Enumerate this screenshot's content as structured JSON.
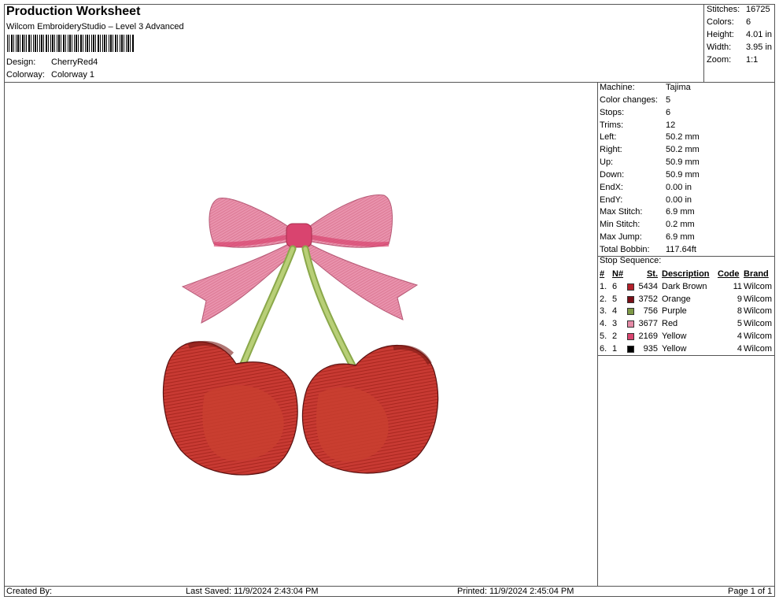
{
  "header": {
    "title": "Production Worksheet",
    "software": "Wilcom EmbroideryStudio – Level 3 Advanced",
    "design_label": "Design:",
    "design_value": "CherryRed4",
    "colorway_label": "Colorway:",
    "colorway_value": "Colorway 1"
  },
  "top_stats": [
    {
      "label": "Stitches:",
      "value": "16725"
    },
    {
      "label": "Colors:",
      "value": "6"
    },
    {
      "label": "Height:",
      "value": "4.01 in"
    },
    {
      "label": "Width:",
      "value": "3.95 in"
    },
    {
      "label": "Zoom:",
      "value": "1:1"
    }
  ],
  "machine_stats": [
    {
      "label": "Machine:",
      "value": "Tajima"
    },
    {
      "label": "Color changes:",
      "value": "5"
    },
    {
      "label": "Stops:",
      "value": "6"
    },
    {
      "label": "Trims:",
      "value": "12"
    },
    {
      "label": "Left:",
      "value": "50.2 mm"
    },
    {
      "label": "Right:",
      "value": "50.2 mm"
    },
    {
      "label": "Up:",
      "value": "50.9 mm"
    },
    {
      "label": "Down:",
      "value": "50.9 mm"
    },
    {
      "label": "EndX:",
      "value": "0.00 in"
    },
    {
      "label": "EndY:",
      "value": "0.00 in"
    },
    {
      "label": "Max Stitch:",
      "value": "6.9 mm"
    },
    {
      "label": "Min Stitch:",
      "value": "0.2 mm"
    },
    {
      "label": "Max Jump:",
      "value": "6.9 mm"
    },
    {
      "label": "Total Bobbin:",
      "value": "117.64ft"
    }
  ],
  "stop_sequence": {
    "label": "Stop Sequence:",
    "headers": {
      "num": "#",
      "n": "N#",
      "st": "St.",
      "description": "Description",
      "code": "Code",
      "brand": "Brand"
    },
    "rows": [
      {
        "num": "1.",
        "n": "6",
        "color": "#b3202a",
        "st": "5434",
        "description": "Dark Brown",
        "code": "11",
        "brand": "Wilcom"
      },
      {
        "num": "2.",
        "n": "5",
        "color": "#7a0f17",
        "st": "3752",
        "description": "Orange",
        "code": "9",
        "brand": "Wilcom"
      },
      {
        "num": "3.",
        "n": "4",
        "color": "#7f9a47",
        "st": "756",
        "description": "Purple",
        "code": "8",
        "brand": "Wilcom"
      },
      {
        "num": "4.",
        "n": "3",
        "color": "#e58aa6",
        "st": "3677",
        "description": "Red",
        "code": "5",
        "brand": "Wilcom"
      },
      {
        "num": "5.",
        "n": "2",
        "color": "#d9446f",
        "st": "2169",
        "description": "Yellow",
        "code": "4",
        "brand": "Wilcom"
      },
      {
        "num": "6.",
        "n": "1",
        "color": "#000000",
        "st": "935",
        "description": "Yellow",
        "code": "4",
        "brand": "Wilcom"
      }
    ]
  },
  "footer": {
    "created_by": "Created By:",
    "last_saved": "Last Saved: 11/9/2024 2:43:04 PM",
    "printed": "Printed: 11/9/2024 2:45:04 PM",
    "page": "Page 1 of 1"
  },
  "colors": {
    "bow_light": "#e89ab1",
    "bow_dark": "#d9446f",
    "stem": "#a6c060",
    "cherry": "#c0322d",
    "cherry_dark": "#8a1a1a"
  }
}
